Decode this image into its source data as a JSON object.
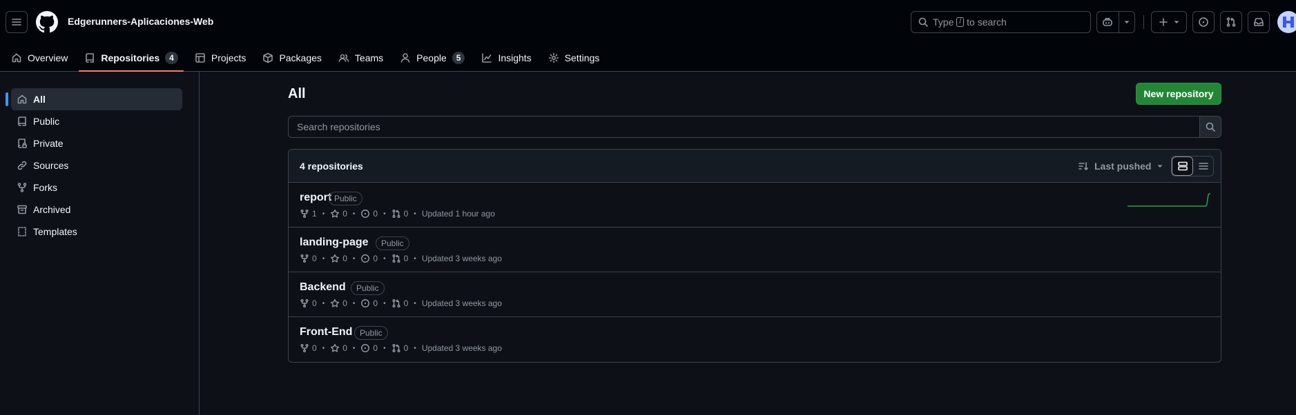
{
  "header": {
    "org_name": "Edgerunners-Aplicaciones-Web",
    "search": {
      "prefix": "Type",
      "key": "/",
      "suffix": "to search"
    }
  },
  "tabs": [
    {
      "label": "Overview"
    },
    {
      "label": "Repositories",
      "count": "4"
    },
    {
      "label": "Projects"
    },
    {
      "label": "Packages"
    },
    {
      "label": "Teams"
    },
    {
      "label": "People",
      "count": "5"
    },
    {
      "label": "Insights"
    },
    {
      "label": "Settings"
    }
  ],
  "sidebar": {
    "items": [
      {
        "label": "All",
        "icon": "home-icon"
      },
      {
        "label": "Public",
        "icon": "repo-icon"
      },
      {
        "label": "Private",
        "icon": "lock-icon"
      },
      {
        "label": "Sources",
        "icon": "link-icon"
      },
      {
        "label": "Forks",
        "icon": "fork-icon"
      },
      {
        "label": "Archived",
        "icon": "archive-icon"
      },
      {
        "label": "Templates",
        "icon": "template-icon"
      }
    ]
  },
  "main": {
    "title": "All",
    "new_repo_label": "New repository",
    "search_placeholder": "Search repositories",
    "count_label": "4 repositories",
    "sort_label": "Last pushed",
    "repos": [
      {
        "name": "report",
        "visibility": "Public",
        "forks": "1",
        "stars": "0",
        "issues": "0",
        "prs": "0",
        "updated": "Updated 1 hour ago"
      },
      {
        "name": "landing-page",
        "visibility": "Public",
        "forks": "0",
        "stars": "0",
        "issues": "0",
        "prs": "0",
        "updated": "Updated 3 weeks ago"
      },
      {
        "name": "Backend",
        "visibility": "Public",
        "forks": "0",
        "stars": "0",
        "issues": "0",
        "prs": "0",
        "updated": "Updated 3 weeks ago"
      },
      {
        "name": "Front-End",
        "visibility": "Public",
        "forks": "0",
        "stars": "0",
        "issues": "0",
        "prs": "0",
        "updated": "Updated 3 weeks ago"
      }
    ]
  },
  "colors": {
    "accent_green": "#238636",
    "active_tab_underline": "#f78166",
    "active_nav_bar": "#4493f8",
    "sparkline": "#2ea043"
  }
}
